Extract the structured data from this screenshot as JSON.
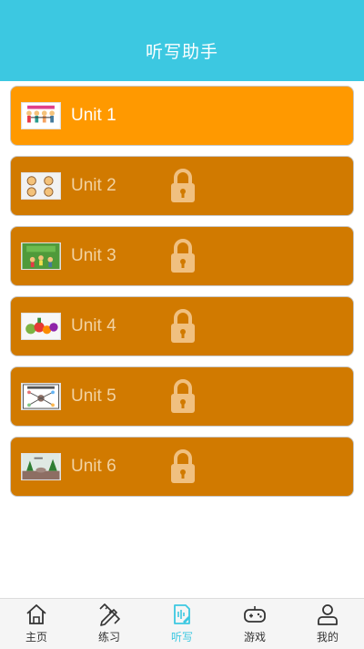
{
  "header": {
    "title": "听写助手"
  },
  "units": [
    {
      "label": "Unit 1",
      "locked": false,
      "thumb": "kids-holding-hands-icon"
    },
    {
      "label": "Unit 2",
      "locked": true,
      "thumb": "children-faces-icon"
    },
    {
      "label": "Unit 3",
      "locked": true,
      "thumb": "playtime-icon"
    },
    {
      "label": "Unit 4",
      "locked": true,
      "thumb": "vegetables-icon"
    },
    {
      "label": "Unit 5",
      "locked": true,
      "thumb": "tree-diagram-icon"
    },
    {
      "label": "Unit 6",
      "locked": true,
      "thumb": "farm-scene-icon"
    }
  ],
  "nav": {
    "items": [
      {
        "label": "主页",
        "icon": "home-icon",
        "active": false
      },
      {
        "label": "练习",
        "icon": "pencil-ruler-icon",
        "active": false
      },
      {
        "label": "听写",
        "icon": "dictation-icon",
        "active": true
      },
      {
        "label": "游戏",
        "icon": "gamepad-icon",
        "active": false
      },
      {
        "label": "我的",
        "icon": "user-icon",
        "active": false
      }
    ]
  },
  "colors": {
    "header": "#3cc8e1",
    "unlocked_card": "#ff9900",
    "locked_card": "#d17a00",
    "active_nav": "#3cc8e1"
  }
}
